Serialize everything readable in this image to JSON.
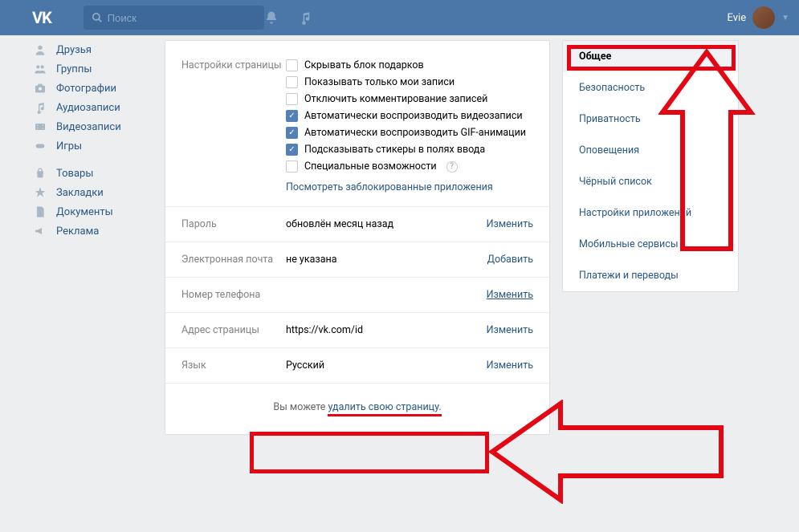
{
  "header": {
    "logo": "VK",
    "search_placeholder": "Поиск",
    "user_name": "Evie"
  },
  "sidebar": {
    "items": [
      {
        "icon": "friends",
        "label": "Друзья"
      },
      {
        "icon": "groups",
        "label": "Группы"
      },
      {
        "icon": "photos",
        "label": "Фотографии"
      },
      {
        "icon": "audio",
        "label": "Аудиозаписи"
      },
      {
        "icon": "video",
        "label": "Видеозаписи"
      },
      {
        "icon": "games",
        "label": "Игры"
      }
    ],
    "items2": [
      {
        "icon": "market",
        "label": "Товары"
      },
      {
        "icon": "bookmarks",
        "label": "Закладки"
      },
      {
        "icon": "docs",
        "label": "Документы"
      },
      {
        "icon": "ads",
        "label": "Реклама"
      }
    ]
  },
  "settings": {
    "page_settings_label": "Настройки страницы",
    "checks": [
      {
        "label": "Скрывать блок подарков",
        "on": false
      },
      {
        "label": "Показывать только мои записи",
        "on": false
      },
      {
        "label": "Отключить комментирование записей",
        "on": false
      },
      {
        "label": "Автоматически воспроизводить видеозаписи",
        "on": true
      },
      {
        "label": "Автоматически воспроизводить GIF-анимации",
        "on": true
      },
      {
        "label": "Подсказывать стикеры в полях ввода",
        "on": true
      },
      {
        "label": "Специальные возможности",
        "on": false,
        "help": true
      }
    ],
    "view_blocked": "Посмотреть заблокированные приложения",
    "rows": [
      {
        "label": "Пароль",
        "value": "обновлён месяц назад",
        "action": "Изменить"
      },
      {
        "label": "Электронная почта",
        "value": "не указана",
        "action": "Добавить"
      },
      {
        "label": "Номер телефона",
        "value": "",
        "action": "Изменить",
        "underline": true
      },
      {
        "label": "Адрес страницы",
        "value": "https://vk.com/id",
        "action": "Изменить"
      },
      {
        "label": "Язык",
        "value": "Русский",
        "action": "Изменить"
      }
    ],
    "delete_prefix": "Вы можете ",
    "delete_link": "удалить свою страницу."
  },
  "rightnav": {
    "items": [
      {
        "label": "Общее",
        "active": true
      },
      {
        "label": "Безопасность"
      },
      {
        "label": "Приватность"
      },
      {
        "label": "Оповещения"
      },
      {
        "label": "Чёрный список"
      },
      {
        "label": "Настройки приложений"
      },
      {
        "label": "Мобильные сервисы"
      },
      {
        "label": "Платежи и переводы"
      }
    ]
  }
}
